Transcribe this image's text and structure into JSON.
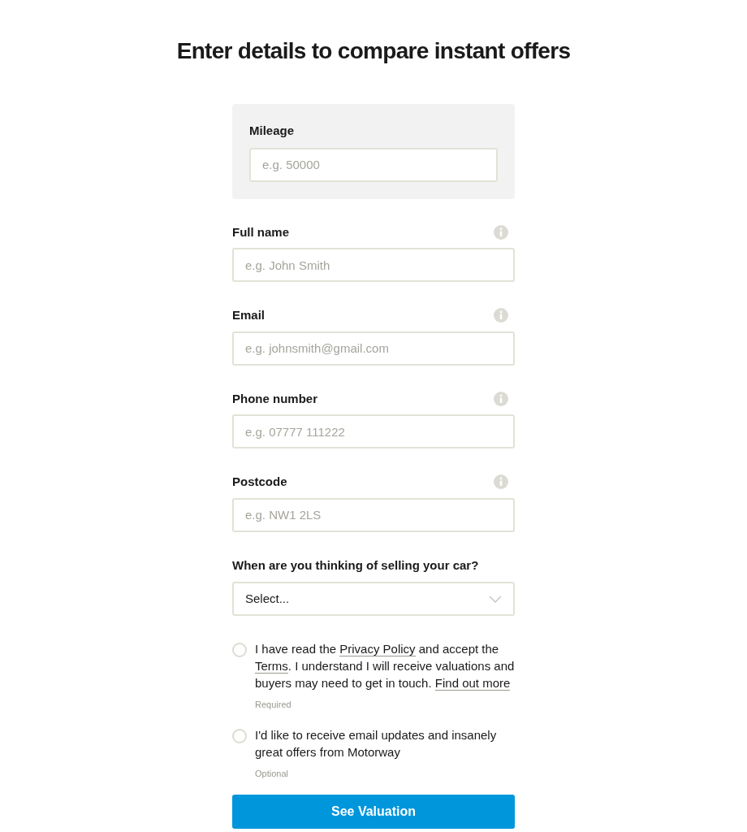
{
  "title": "Enter details to compare instant offers",
  "mileage": {
    "label": "Mileage",
    "placeholder": "e.g. 50000"
  },
  "fields": [
    {
      "label": "Full name",
      "placeholder": "e.g. John Smith"
    },
    {
      "label": "Email",
      "placeholder": "e.g. johnsmith@gmail.com"
    },
    {
      "label": "Phone number",
      "placeholder": "e.g. 07777 111222"
    },
    {
      "label": "Postcode",
      "placeholder": "e.g. NW1 2LS"
    }
  ],
  "timing": {
    "label": "When are you thinking of selling your car?",
    "value": "Select..."
  },
  "consents": [
    {
      "checked": false,
      "parts": [
        {
          "kind": "text",
          "text": "I have read the "
        },
        {
          "kind": "link",
          "text": "Privacy Policy"
        },
        {
          "kind": "text",
          "text": " and accept the "
        },
        {
          "kind": "link",
          "text": "Terms"
        },
        {
          "kind": "text",
          "text": ". I understand I will receive valuations and buyers may need to get in touch. "
        },
        {
          "kind": "link",
          "text": "Find out more"
        }
      ],
      "note": "Required"
    },
    {
      "checked": false,
      "parts": [
        {
          "kind": "text",
          "text": "I'd like to receive email updates and insanely great offers from Motorway"
        }
      ],
      "note": "Optional"
    }
  ],
  "submit": "See Valuation"
}
